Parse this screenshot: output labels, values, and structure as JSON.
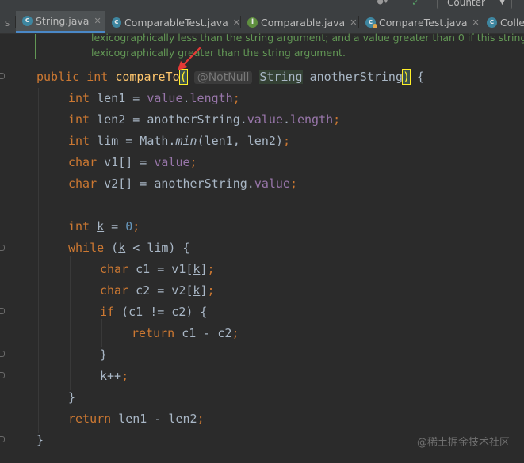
{
  "toolbar": {
    "run_config_label": "Counter"
  },
  "tabs": [
    {
      "label": "String.java",
      "icon": "java-class-icon",
      "active": true
    },
    {
      "label": "ComparableTest.java",
      "icon": "java-class-icon",
      "active": false
    },
    {
      "label": "Comparable.java",
      "icon": "java-interface-icon",
      "active": false
    },
    {
      "label": "CompareTest.java",
      "icon": "java-runnable-class-icon",
      "active": false
    },
    {
      "label": "Colle",
      "icon": "java-class-icon",
      "active": false
    }
  ],
  "doc_comment": {
    "line1": "lexicographically less than the string argument; and a value greater than 0 if this string is",
    "line2": "lexicographically greater than the string argument."
  },
  "code": {
    "sig_public": "public",
    "sig_int": "int",
    "sig_name": "compareTo",
    "sig_open": "(",
    "sig_hint": "@NotNull",
    "sig_type": "String",
    "sig_param": "anotherString",
    "sig_close": ")",
    "sig_brace": " {",
    "l1": {
      "kw": "int",
      "var": " len1 = ",
      "fld": "value",
      "dot": ".",
      "fld2": "length",
      "semi": ";"
    },
    "l2": {
      "kw": "int",
      "var": " len2 = anotherString.",
      "fld": "value",
      "dot": ".",
      "fld2": "length",
      "semi": ";"
    },
    "l3": {
      "kw": "int",
      "var": " lim = Math.",
      "fn": "min",
      "rest": "(len1, len2)",
      "semi": ";"
    },
    "l4": {
      "kw": "char",
      "var": " v1[] = ",
      "fld": "value",
      "semi": ";"
    },
    "l5": {
      "kw": "char",
      "var": " v2[] = anotherString.",
      "fld": "value",
      "semi": ";"
    },
    "l6": {
      "kw": "int",
      "sp": " ",
      "var": "k",
      "eq": " = ",
      "num": "0",
      "semi": ";"
    },
    "l7": {
      "kw": "while",
      "a": " (",
      "k": "k",
      "rest": " < lim) {"
    },
    "l8": {
      "kw": "char",
      "a": " c1 = v1[",
      "k": "k",
      "b": "]",
      "semi": ";"
    },
    "l9": {
      "kw": "char",
      "a": " c2 = v2[",
      "k": "k",
      "b": "]",
      "semi": ";"
    },
    "l10": {
      "kw": "if",
      "rest": " (c1 != c2) {"
    },
    "l11": {
      "kw": "return",
      "rest": " c1 - c2",
      "semi": ";"
    },
    "l12": "}",
    "l13": {
      "k": "k",
      "rest": "++",
      "semi": ";"
    },
    "l14": "}",
    "l15": {
      "kw": "return",
      "rest": " len1 - len2",
      "semi": ";"
    },
    "l16": "}"
  },
  "watermark": "@稀土掘金技术社区",
  "colors": {
    "background": "#2b2b2b",
    "keyword": "#cc7832",
    "field": "#9876aa",
    "method": "#ffc66d",
    "number": "#6897bb",
    "text": "#a9b7c6",
    "doc_comment": "#629755",
    "active_tab_underline": "#4a88c7",
    "annotation_arrow": "#e53935"
  }
}
